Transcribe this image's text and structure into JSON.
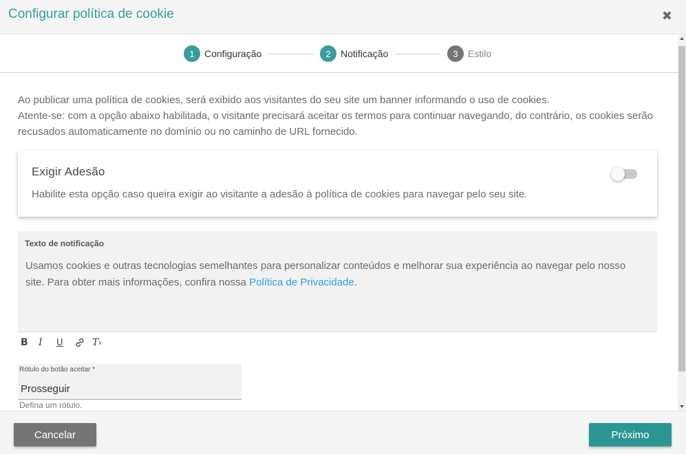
{
  "dialog": {
    "title": "Configurar política de cookie",
    "close_icon": "close-icon"
  },
  "stepper": {
    "steps": [
      {
        "number": "1",
        "label": "Configuração",
        "state": "done"
      },
      {
        "number": "2",
        "label": "Notificação",
        "state": "current"
      },
      {
        "number": "3",
        "label": "Estilo",
        "state": "pending"
      }
    ]
  },
  "intro": {
    "line1": "Ao publicar uma política de cookies, será exibido aos visitantes do seu site um banner informando o uso de cookies.",
    "line2": "Atente-se: com a opção abaixo habilitada, o visitante precisará aceitar os termos para continuar navegando, do contrário, os cookies serão recusados automaticamente no domínio ou no caminho de URL fornecido."
  },
  "adhesion": {
    "title": "Exigir Adesão",
    "description": "Habilite esta opção caso queira exigir ao visitante a adesão à política de cookies para navegar pelo seu site.",
    "enabled": false
  },
  "notification": {
    "label": "Texto de notificação",
    "text": "Usamos cookies e outras tecnologias semelhantes para personalizar conteúdos e melhorar sua experiência ao navegar pelo nosso site. Para obter mais informações, confira nossa ",
    "link_text": "Política de Privacidade",
    "text_end": "."
  },
  "editor_toolbar": {
    "bold": "B",
    "italic": "I",
    "underline": "U",
    "link_icon": "link-icon",
    "clear_format": "T",
    "clear_format_sub": "x"
  },
  "accept_field": {
    "label": "Rótulo do botão aceitar *",
    "value": "Prosseguir",
    "hint": "Defina um rótulo."
  },
  "footer": {
    "cancel_label": "Cancelar",
    "next_label": "Próximo"
  },
  "colors": {
    "accent": "#2e9fa0",
    "step_active": "#3a9c9b",
    "step_inactive": "#757575",
    "link": "#2d9fdc",
    "primary_button": "#2b9693",
    "secondary_button": "#757575"
  }
}
